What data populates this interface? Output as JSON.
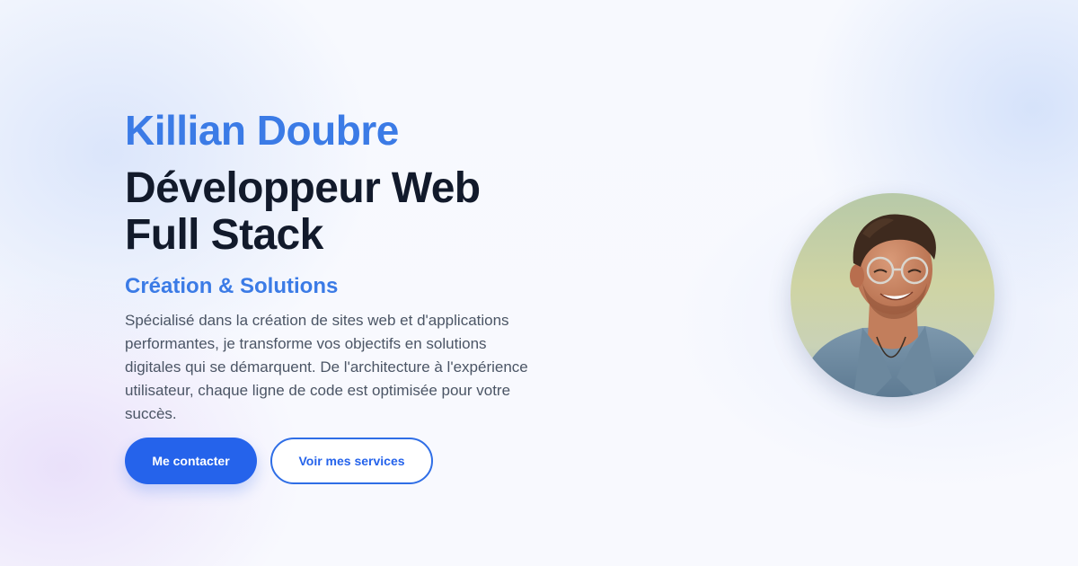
{
  "hero": {
    "name": "Killian Doubre",
    "role_line1": "Développeur Web",
    "role_line2": "Full Stack",
    "tagline": "Création & Solutions",
    "description": "Spécialisé dans la création de sites web et d'applications performantes, je transforme vos objectifs en solutions digitales qui se démarquent. De l'architecture à l'expérience utilisateur, chaque ligne de code est optimisée pour votre succès."
  },
  "actions": {
    "contact_label": "Me contacter",
    "services_label": "Voir mes services"
  },
  "avatar": {
    "icon": "profile-photo"
  },
  "colors": {
    "accent": "#3b7be6",
    "primary_button": "#2563eb",
    "heading": "#121a2b",
    "body_text": "#4b5565",
    "background": "#f6f8fd"
  }
}
